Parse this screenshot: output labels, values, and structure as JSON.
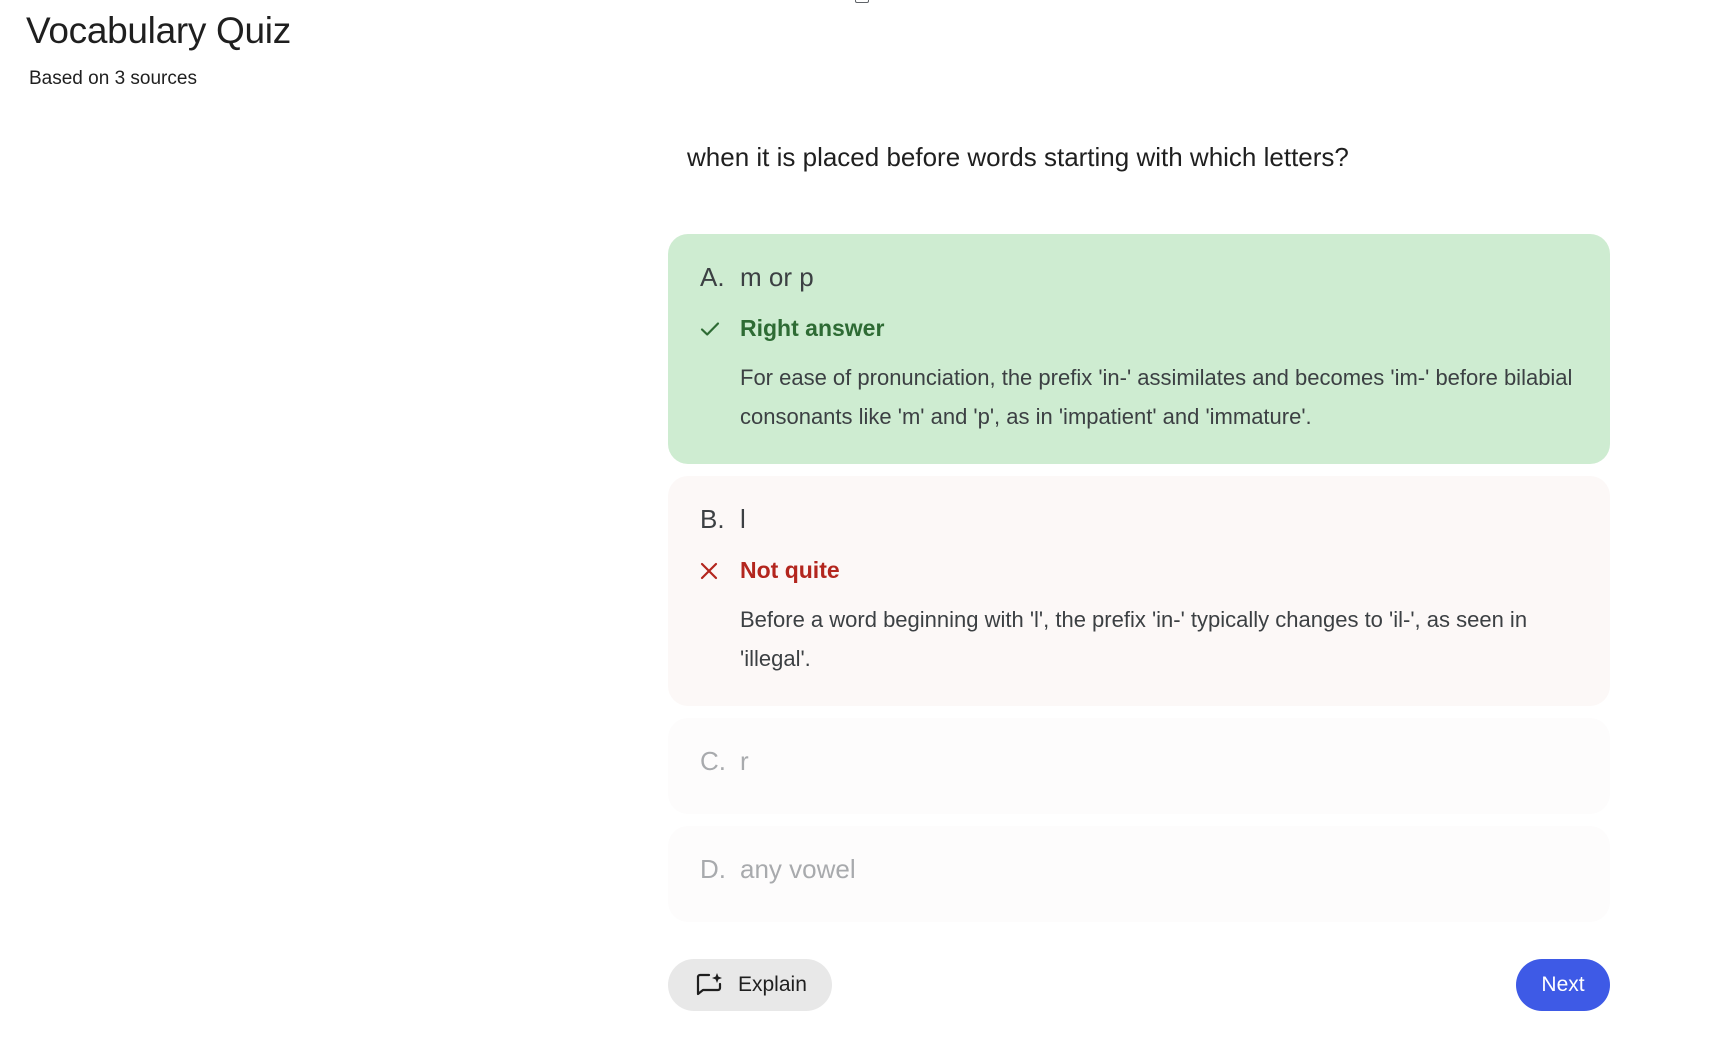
{
  "header": {
    "title": "Vocabulary Quiz",
    "subtitle": "Based on 3 sources"
  },
  "question": {
    "text": "when it is placed before words starting with which letters?"
  },
  "options": [
    {
      "letter": "A.",
      "text": "m or p",
      "status": "correct",
      "feedback_label": "Right answer",
      "feedback_icon": "check-icon",
      "explanation": "For ease of pronunciation, the prefix 'in-' assimilates and becomes 'im-' before bilabial consonants like 'm' and 'p', as in 'impatient' and 'immature'."
    },
    {
      "letter": "B.",
      "text": "l",
      "status": "incorrect",
      "feedback_label": "Not quite",
      "feedback_icon": "close-icon",
      "explanation": "Before a word beginning with 'l', the prefix 'in-' typically changes to 'il-', as seen in 'illegal'."
    },
    {
      "letter": "C.",
      "text": "r",
      "status": "unselected"
    },
    {
      "letter": "D.",
      "text": "any vowel",
      "status": "unselected"
    }
  ],
  "actions": {
    "explain_label": "Explain",
    "explain_icon": "explain-sparkle-icon",
    "next_label": "Next"
  },
  "colors": {
    "correct_bg": "#ceecd1",
    "correct_text": "#2e6b34",
    "incorrect_bg": "#fcf8f7",
    "incorrect_text": "#b3261e",
    "primary": "#3e5ae6"
  }
}
